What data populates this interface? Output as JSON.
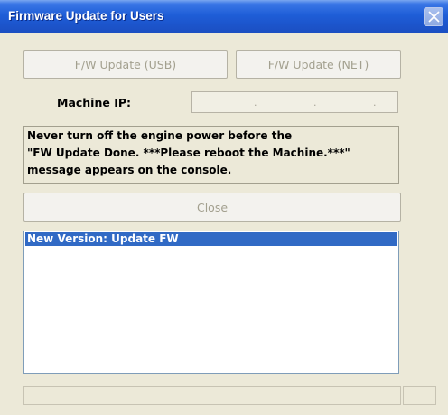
{
  "window": {
    "title": "Firmware Update for Users"
  },
  "buttons": {
    "usb": "F/W Update (USB)",
    "net": "F/W Update (NET)",
    "close": "Close"
  },
  "machine_ip": {
    "label": "Machine IP:",
    "octets": [
      "",
      "",
      "",
      ""
    ]
  },
  "message": {
    "lines": [
      "Never turn off the engine power before the",
      "\"FW Update Done. ***Please reboot the Machine.***\"",
      "message appears on the console."
    ]
  },
  "list": {
    "items": [
      "New Version: Update FW"
    ],
    "selected_index": 0
  },
  "status": {
    "text": "",
    "extra": ""
  }
}
